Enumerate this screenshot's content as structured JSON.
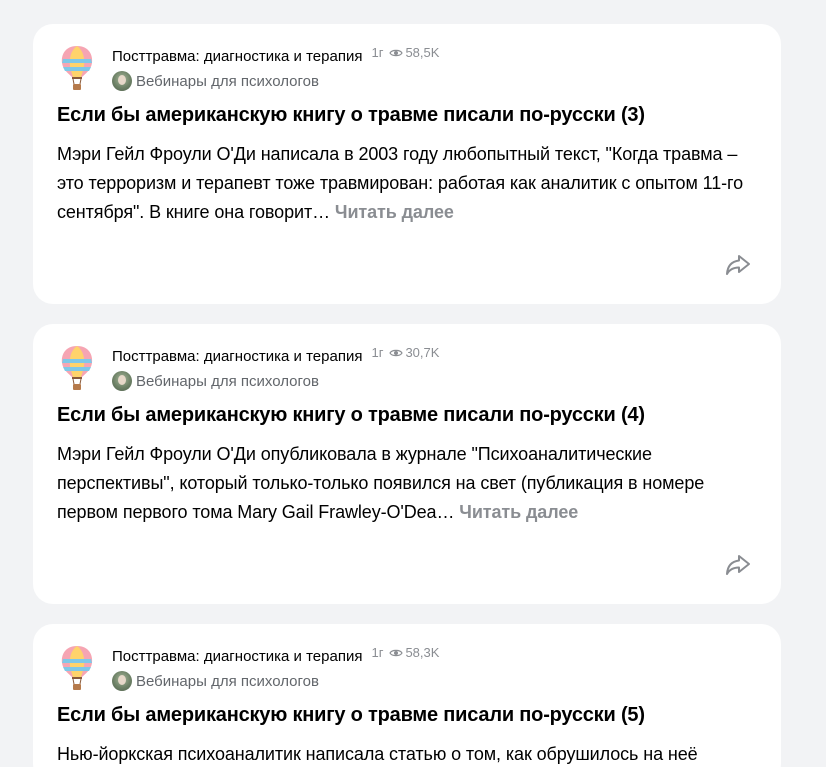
{
  "feed": {
    "items": [
      {
        "channel": "Посттравма: диагностика и терапия",
        "age": "1г",
        "views": "58,5K",
        "source": "Вебинары для психологов",
        "title": "Если бы американскую книгу о травме писали по-русски (3)",
        "text": "Мэри Гейл Фроули О'Ди написала в 2003 году любопытный текст, \"Когда травма – это терроризм и терапевт тоже травмирован: работая как аналитик с опытом 11-го сентября\". В книге она говорит…",
        "read_more": "Читать далее"
      },
      {
        "channel": "Посттравма: диагностика и терапия",
        "age": "1г",
        "views": "30,7K",
        "source": "Вебинары для психологов",
        "title": "Если бы американскую книгу о травме писали по-русски (4)",
        "text": "Мэри Гейл Фроули О'Ди опубликовала в журнале \"Психоаналитические перспективы\", который только-только появился на свет (публикация в номере первом первого тома Mary Gail Frawley-O'Dea…",
        "read_more": "Читать далее"
      },
      {
        "channel": "Посттравма: диагностика и терапия",
        "age": "1г",
        "views": "58,3K",
        "source": "Вебинары для психологов",
        "title": "Если бы американскую книгу о травме писали по-русски (5)",
        "text": "Нью-йоркская психоаналитик написала статью о том, как обрушилось на неё",
        "read_more": ""
      }
    ]
  },
  "icons": {
    "channel_avatar": "hot-air-balloon-icon",
    "views": "eye-icon",
    "share": "share-arrow-icon"
  },
  "colors": {
    "background": "#f2f3f5",
    "card": "#ffffff",
    "muted_text": "#8a8d92",
    "source_text": "#62666b"
  }
}
